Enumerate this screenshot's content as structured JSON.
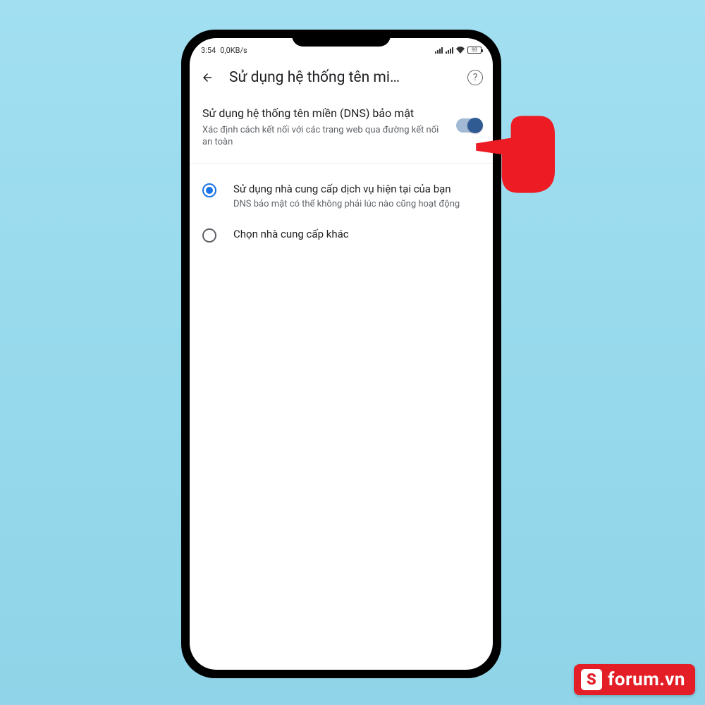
{
  "status": {
    "time": "3:54",
    "net_speed": "0,0KB/s",
    "battery_pct": "93"
  },
  "header": {
    "title": "Sử dụng hệ thống tên mi…"
  },
  "setting": {
    "title": "Sử dụng hệ thống tên miền (DNS) bảo mật",
    "subtitle": "Xác định cách kết nối với các trang web qua đường kết nối an toàn",
    "toggle_on": true
  },
  "options": [
    {
      "title": "Sử dụng nhà cung cấp dịch vụ hiện tại của bạn",
      "subtitle": "DNS bảo mật có thể không phải lúc nào cũng hoạt động",
      "selected": true
    },
    {
      "title": "Chọn nhà cung cấp khác",
      "subtitle": "",
      "selected": false
    }
  ],
  "watermark": {
    "logo_letter": "S",
    "text": "forum.vn"
  }
}
